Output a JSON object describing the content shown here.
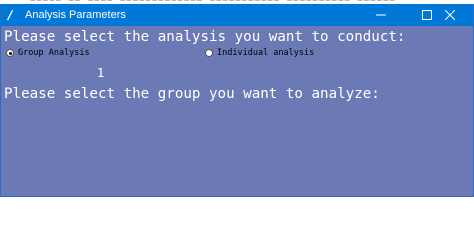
{
  "window": {
    "title": "Analysis Parameters",
    "icon": "feather-icon",
    "accent_color": "#0078d7",
    "background_color": "#6b7ab4"
  },
  "content": {
    "prompt_analysis": "Please select the analysis you want to conduct:",
    "options": [
      {
        "label": "Group Analysis",
        "selected": true
      },
      {
        "label": "Individual analysis",
        "selected": false
      }
    ],
    "count_value": "1",
    "prompt_group": "Please select the group you want to analyze:"
  }
}
